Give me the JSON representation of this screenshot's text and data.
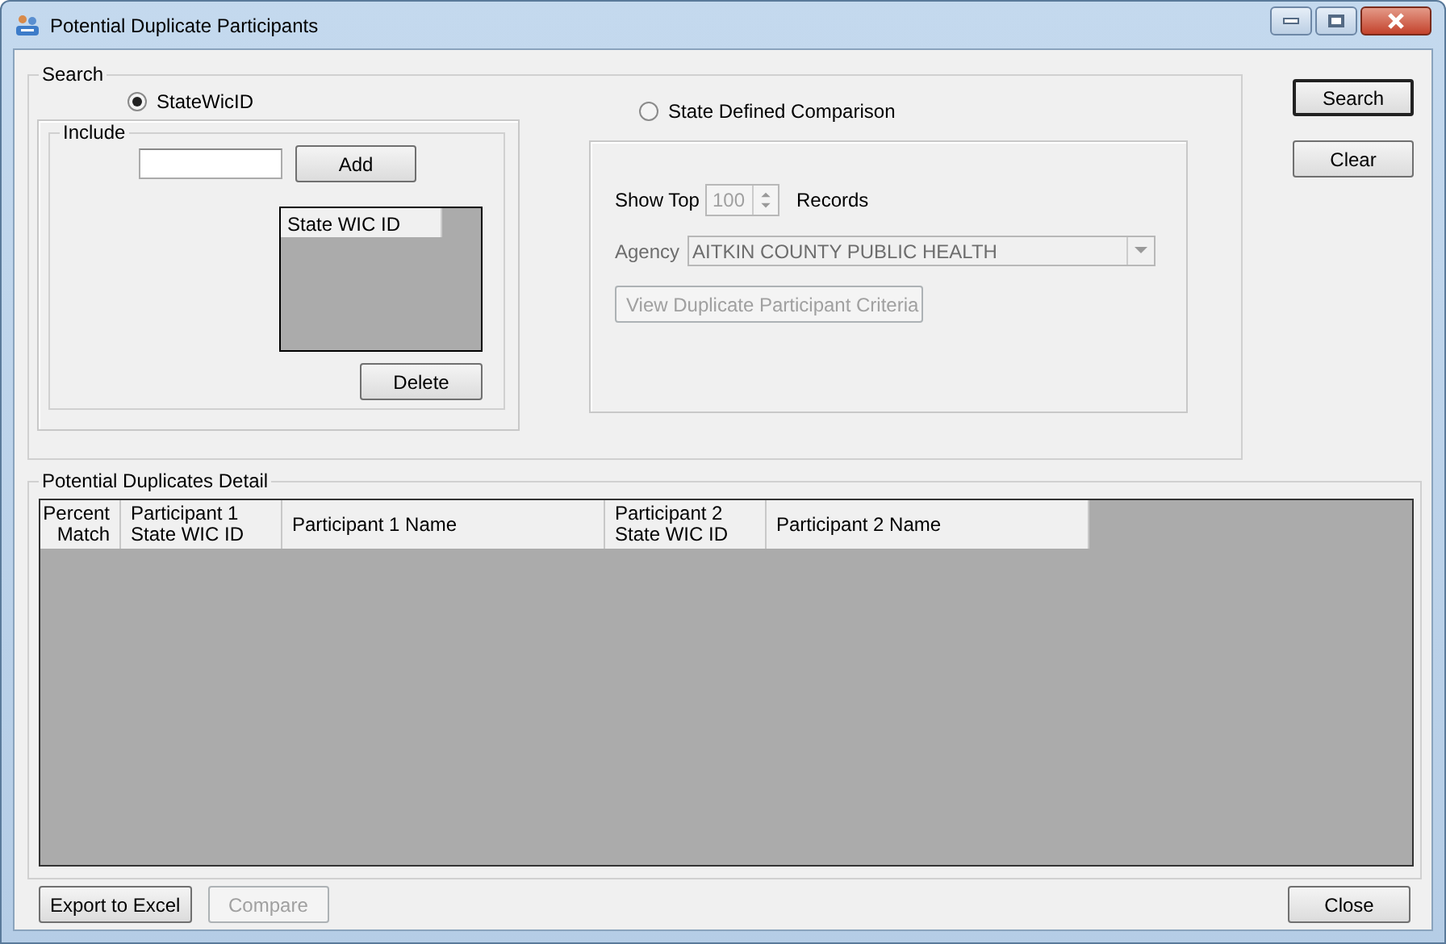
{
  "window": {
    "title": "Potential Duplicate Participants"
  },
  "search": {
    "legend": "Search",
    "modes": [
      {
        "label": "StateWicID",
        "selected": true
      },
      {
        "label": "State Defined Comparison",
        "selected": false
      }
    ],
    "include": {
      "legend": "Include",
      "add_button": "Add",
      "list_header": "State WIC ID",
      "delete_button": "Delete"
    },
    "criteria": {
      "show_top": {
        "label": "Show Top",
        "value": "100",
        "unit": "Records",
        "disabled": true
      },
      "agency": {
        "label": "Agency",
        "value": "AITKIN COUNTY PUBLIC HEALTH",
        "disabled": true
      },
      "button": {
        "label": "View Duplicate Participant Criteria",
        "disabled": true
      }
    }
  },
  "side_buttons": [
    {
      "label": "Search",
      "default": true
    },
    {
      "label": "Clear",
      "default": false
    }
  ],
  "detail": {
    "legend": "Potential Duplicates Detail",
    "columns": [
      {
        "lines": [
          "Percent",
          "Match"
        ],
        "kind": "number"
      },
      {
        "lines": [
          "Participant 1",
          "State WIC ID"
        ],
        "kind": "text"
      },
      {
        "lines": [
          "Participant 1 Name"
        ],
        "kind": "text"
      },
      {
        "lines": [
          "Participant 2",
          "State WIC ID"
        ],
        "kind": "text"
      },
      {
        "lines": [
          "Participant 2 Name"
        ],
        "kind": "text"
      }
    ]
  },
  "bottom_buttons": [
    {
      "label": "Export to Excel",
      "disabled": false
    },
    {
      "label": "Compare",
      "disabled": true
    }
  ],
  "close_button": "Close"
}
